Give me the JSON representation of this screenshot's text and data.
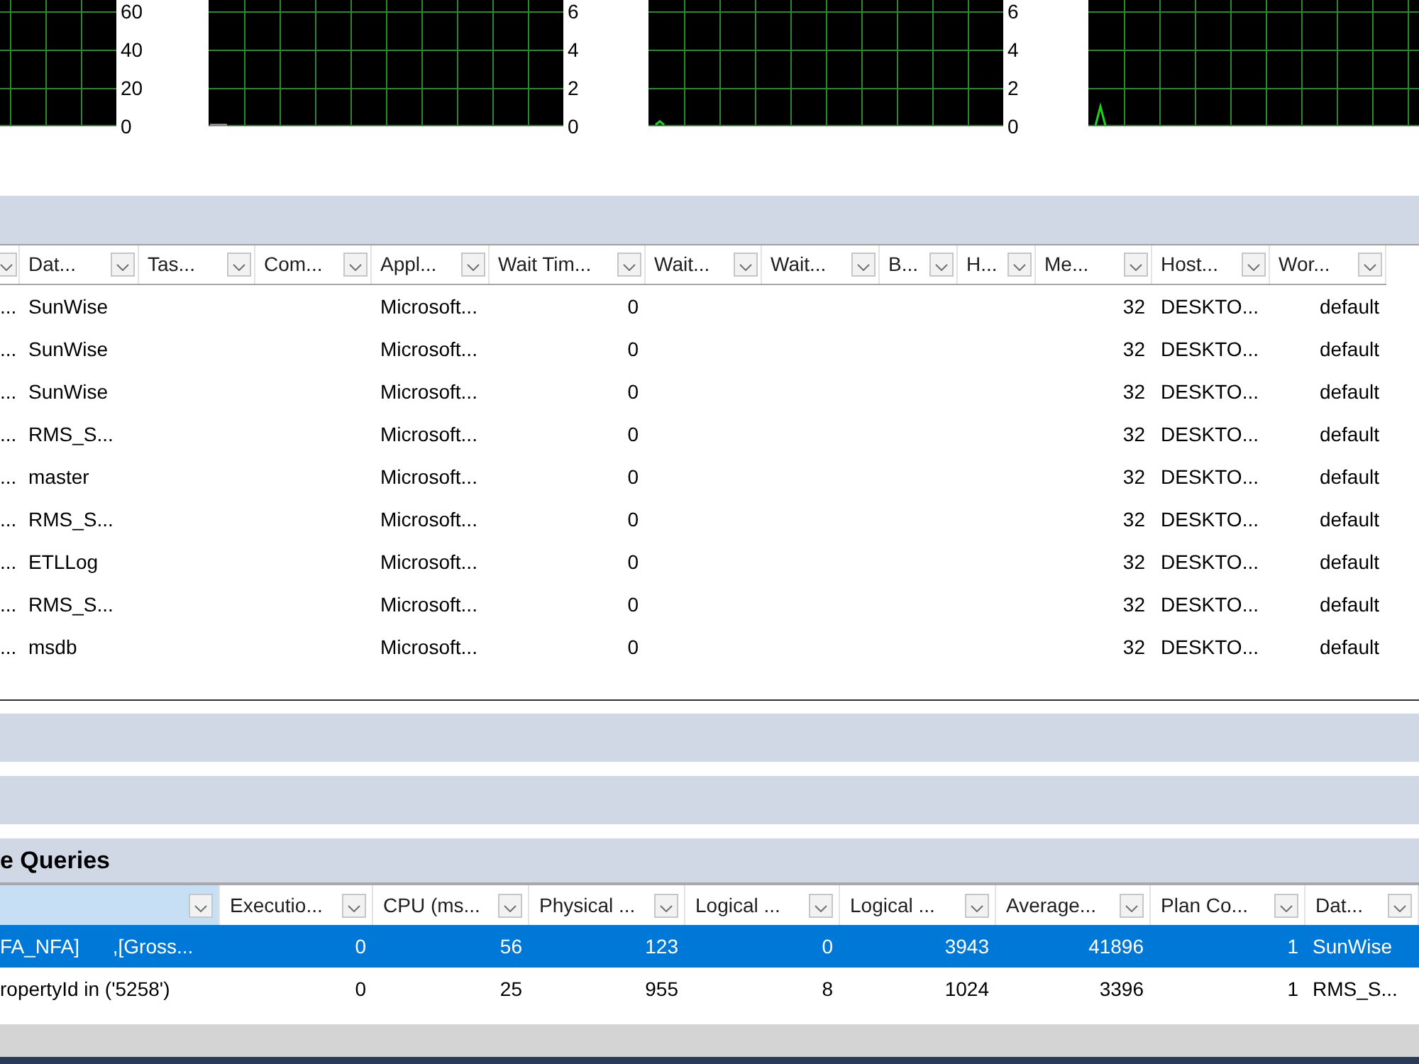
{
  "graph_axis_labels": [
    [
      "60",
      "40",
      "20",
      "0"
    ],
    [
      "6",
      "4",
      "2",
      "0"
    ],
    [
      "6",
      "4",
      "2",
      "0"
    ]
  ],
  "processes": {
    "expanded": true,
    "columns": [
      {
        "selected": false
      },
      {
        "label": "Dat...",
        "selected": false
      },
      {
        "label": "Tas...",
        "selected": false
      },
      {
        "label": "Com...",
        "selected": false
      },
      {
        "label": "Appl...",
        "selected": false
      },
      {
        "label": "Wait Tim...",
        "selected": false
      },
      {
        "label": "Wait...",
        "selected": false
      },
      {
        "label": "Wait...",
        "selected": false
      },
      {
        "label": "B...",
        "selected": false
      },
      {
        "label": "H...",
        "selected": false
      },
      {
        "label": "Me...",
        "selected": false
      },
      {
        "label": "Host...",
        "selected": false
      },
      {
        "label": "Wor...",
        "selected": false
      }
    ],
    "rows": [
      {
        "column_0": "...",
        "column_1": "SunWise",
        "column_4": "Microsoft...",
        "column_5": "0",
        "column_10": "32",
        "column_11": "DESKTO...",
        "column_12": "default"
      },
      {
        "column_0": "...",
        "column_1": "SunWise",
        "column_4": "Microsoft...",
        "column_5": "0",
        "column_10": "32",
        "column_11": "DESKTO...",
        "column_12": "default"
      },
      {
        "column_0": "...",
        "column_1": "SunWise",
        "column_4": "Microsoft...",
        "column_5": "0",
        "column_10": "32",
        "column_11": "DESKTO...",
        "column_12": "default"
      },
      {
        "column_0": "...",
        "column_1": "RMS_S...",
        "column_4": "Microsoft...",
        "column_5": "0",
        "column_10": "32",
        "column_11": "DESKTO...",
        "column_12": "default"
      },
      {
        "column_0": "...",
        "column_1": "master",
        "column_4": "Microsoft...",
        "column_5": "0",
        "column_10": "32",
        "column_11": "DESKTO...",
        "column_12": "default"
      },
      {
        "column_0": "...",
        "column_1": "RMS_S...",
        "column_4": "Microsoft...",
        "column_5": "0",
        "column_10": "32",
        "column_11": "DESKTO...",
        "column_12": "default"
      },
      {
        "column_0": "...",
        "column_1": "ETLLog",
        "column_4": "Microsoft...",
        "column_5": "0",
        "column_10": "32",
        "column_11": "DESKTO...",
        "column_12": "default"
      },
      {
        "column_0": "...",
        "column_1": "RMS_S...",
        "column_4": "Microsoft...",
        "column_5": "0",
        "column_10": "32",
        "column_11": "DESKTO...",
        "column_12": "default"
      },
      {
        "column_0": "...",
        "column_1": "msdb",
        "column_4": "Microsoft...",
        "column_5": "0",
        "column_10": "32",
        "column_11": "DESKTO...",
        "column_12": "default"
      }
    ]
  },
  "queries": {
    "title": "e Queries",
    "expanded": true,
    "columns": [
      {
        "selected": true
      },
      {
        "label": "Executio...",
        "selected": false
      },
      {
        "label": "CPU (ms...",
        "selected": false
      },
      {
        "label": "Physical ...",
        "selected": false
      },
      {
        "label": "Logical ...",
        "selected": false
      },
      {
        "label": "Logical ...",
        "selected": false
      },
      {
        "label": "Average...",
        "selected": false
      },
      {
        "label": "Plan Co...",
        "selected": false
      },
      {
        "label": "Dat...",
        "selected": false
      }
    ],
    "rows": [
      {
        "selected": true,
        "column_0": "FA_NFA]      ,[Gross...",
        "column_1": "0",
        "column_2": "56",
        "column_3": "123",
        "column_4": "0",
        "column_5": "3943",
        "column_6": "41896",
        "column_7": "1",
        "column_8": "SunWise"
      },
      {
        "selected": false,
        "column_0": "ropertyId in ('5258')",
        "column_1": "0",
        "column_2": "25",
        "column_3": "955",
        "column_4": "8",
        "column_5": "1024",
        "column_6": "3396",
        "column_7": "1",
        "column_8": "RMS_S..."
      }
    ]
  }
}
